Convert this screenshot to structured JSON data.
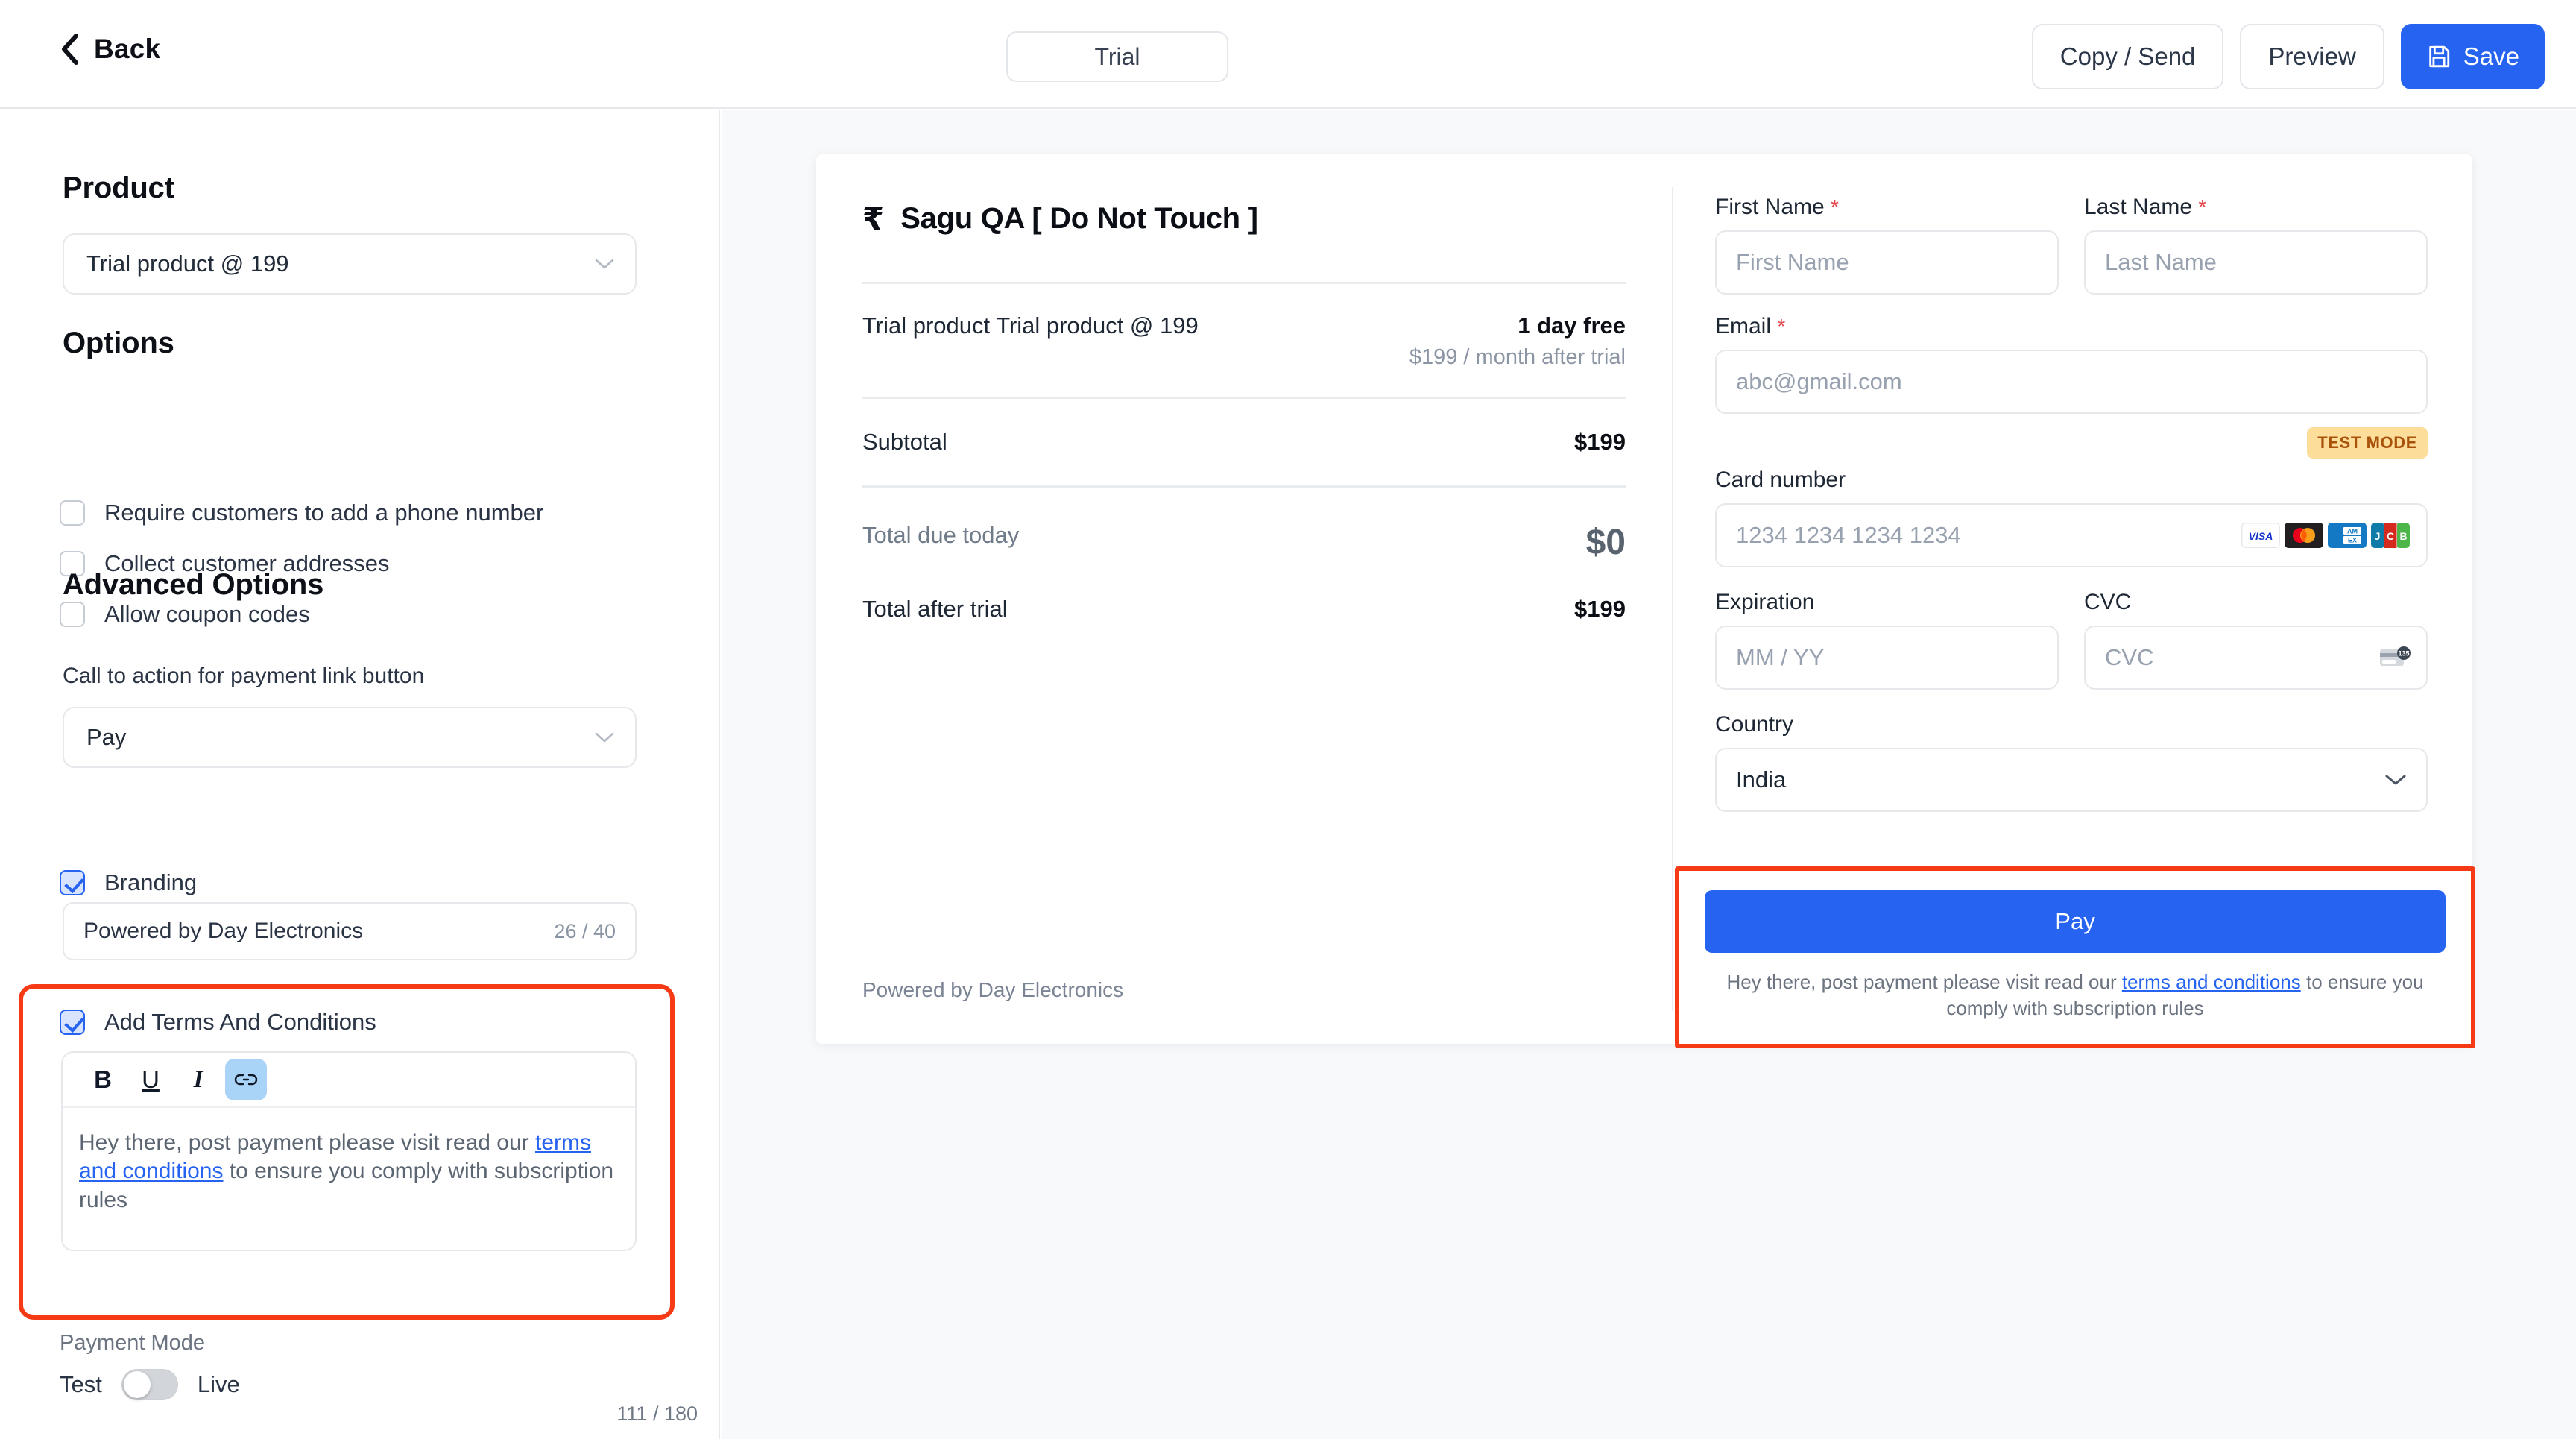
{
  "topbar": {
    "back_label": "Back",
    "tab_label": "Trial",
    "copy_send_label": "Copy / Send",
    "preview_label": "Preview",
    "save_label": "Save"
  },
  "sidebar": {
    "product_heading": "Product",
    "product_selected": "Trial product @ 199",
    "options_heading": "Options",
    "options": [
      {
        "label": "Require customers to add a phone number",
        "checked": false
      },
      {
        "label": "Collect customer addresses",
        "checked": false
      },
      {
        "label": "Allow coupon codes",
        "checked": false
      }
    ],
    "advanced_heading": "Advanced Options",
    "cta_label": "Call to action for payment link button",
    "cta_selected": "Pay",
    "branding_label": "Branding",
    "branding_value": "Powered by Day Electronics",
    "branding_count": "26 / 40",
    "terms_label": "Add Terms And Conditions",
    "editor_toolbar": {
      "bold": "B",
      "underline": "U",
      "italic": "I",
      "link": "link-icon"
    },
    "terms_text_part1": "Hey there, post payment please visit read our ",
    "terms_link": "terms and conditions",
    "terms_text_part2": " to ensure you comply with subscription rules",
    "terms_count": "111 / 180",
    "payment_mode_label": "Payment Mode",
    "payment_mode_left": "Test",
    "payment_mode_right": "Live",
    "payment_mode_value": "Test"
  },
  "checkout": {
    "currency_symbol": "₹",
    "merchant_name": "Sagu QA [ Do Not Touch ]",
    "summary": {
      "item_label": "Trial product Trial product @ 199",
      "item_primary": "1 day free",
      "item_secondary": "$199 / month after trial",
      "subtotal_label": "Subtotal",
      "subtotal_value": "$199",
      "due_today_label": "Total due today",
      "due_today_value": "$0",
      "after_trial_label": "Total after trial",
      "after_trial_value": "$199"
    },
    "powered_by": "Powered by Day Electronics",
    "form": {
      "first_name_label": "First Name",
      "first_name_placeholder": "First Name",
      "first_name_value": "",
      "last_name_label": "Last Name",
      "last_name_placeholder": "Last Name",
      "last_name_value": "",
      "email_label": "Email",
      "email_placeholder": "abc@gmail.com",
      "email_value": "",
      "required_mark": "*",
      "test_mode_badge": "TEST MODE",
      "card_number_label": "Card number",
      "card_number_placeholder": "1234 1234 1234 1234",
      "card_number_value": "",
      "card_brands": [
        "visa-icon",
        "mastercard-icon",
        "amex-icon",
        "jcb-icon"
      ],
      "expiration_label": "Expiration",
      "expiration_placeholder": "MM / YY",
      "expiration_value": "",
      "cvc_label": "CVC",
      "cvc_placeholder": "CVC",
      "cvc_value": "",
      "country_label": "Country",
      "country_value": "India",
      "pay_button_label": "Pay",
      "pay_terms_part1": "Hey there, post payment please visit read our ",
      "pay_terms_link": "terms and conditions",
      "pay_terms_part2": " to ensure you comply with subscription rules"
    }
  },
  "colors": {
    "accent_blue": "#2563f0",
    "highlight_red": "#f53a15",
    "test_badge_bg": "#fcdd9a",
    "test_badge_text": "#a8520a",
    "page_bg": "#f7f9fb"
  }
}
